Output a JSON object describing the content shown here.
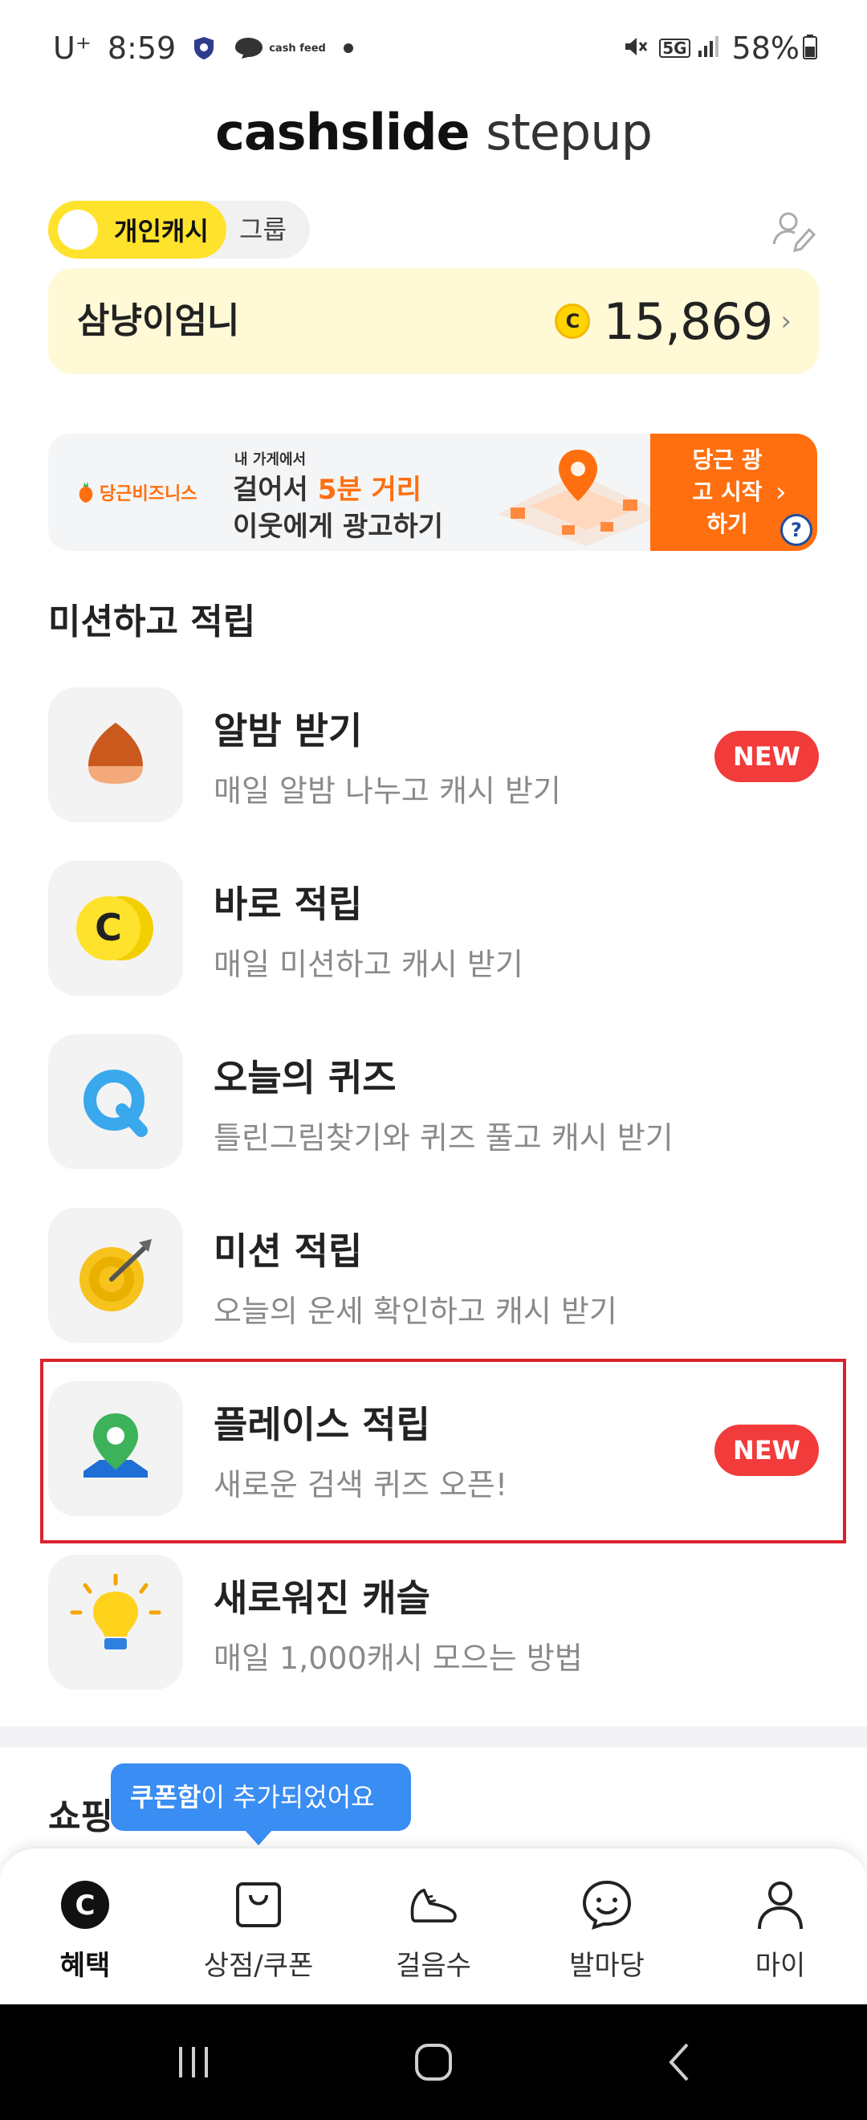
{
  "status_bar": {
    "carrier": "U⁺",
    "time": "8:59",
    "cashfeed_label": "cash feed",
    "network": "5G",
    "battery": "58%"
  },
  "header": {
    "title_main": "cashslide",
    "title_sub": "stepup"
  },
  "mode_toggle": {
    "personal": "개인캐시",
    "group": "그룹"
  },
  "balance": {
    "name": "삼냥이엄니",
    "coin_symbol": "C",
    "amount": "15,869"
  },
  "ad": {
    "brand": "당근비즈니스",
    "eyebrow": "내 가게에서",
    "line1_prefix": "걸어서 ",
    "line1_accent": "5분 거리",
    "line2": "이웃에게 광고하기",
    "cta": "당근 광고 시작하기",
    "help": "?"
  },
  "missions": {
    "section_title": "미션하고 적립",
    "items": [
      {
        "title": "알밤 받기",
        "subtitle": "매일 알밤 나누고 캐시 받기",
        "badge": "NEW"
      },
      {
        "title": "바로 적립",
        "subtitle": "매일 미션하고 캐시 받기"
      },
      {
        "title": "오늘의 퀴즈",
        "subtitle": "틀린그림찾기와 퀴즈 풀고 캐시 받기"
      },
      {
        "title": "미션 적립",
        "subtitle": "오늘의 운세 확인하고 캐시 받기"
      },
      {
        "title": "플레이스 적립",
        "subtitle": "새로운 검색 퀴즈 오픈!",
        "badge": "NEW"
      },
      {
        "title": "새로워진 캐슬",
        "subtitle": "매일 1,000캐시 모으는 방법"
      }
    ]
  },
  "shopping": {
    "title_visible": "쇼핑"
  },
  "tooltip": {
    "strong": "쿠폰함",
    "rest": "이 추가되었어요"
  },
  "bottom_nav": {
    "items": [
      {
        "label": "혜택",
        "icon": "coin-c-icon",
        "active": true
      },
      {
        "label": "상점/쿠폰",
        "icon": "shopping-bag-icon"
      },
      {
        "label": "걸음수",
        "icon": "sneaker-icon"
      },
      {
        "label": "발마당",
        "icon": "chat-smile-icon"
      },
      {
        "label": "마이",
        "icon": "person-icon"
      }
    ]
  },
  "colors": {
    "brand_yellow": "#ffe22c",
    "balance_bg": "#fff9d6",
    "new_badge": "#f23b3b",
    "tooltip_blue": "#3a8df2",
    "ad_orange": "#ff6f0f",
    "highlight_red": "#d9232d"
  }
}
